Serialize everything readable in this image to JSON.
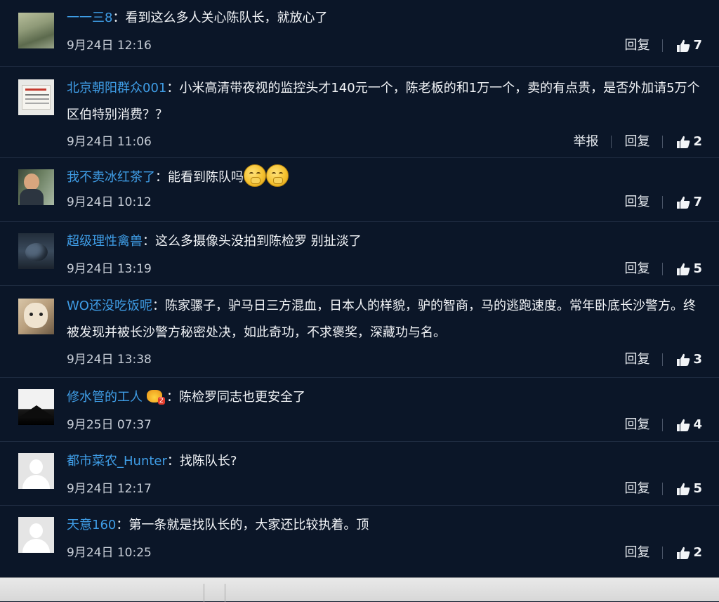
{
  "comments": [
    {
      "user": "一一三8",
      "text": "看到这么多人关心陈队长，就放心了",
      "time": "9月24日 12:16",
      "reply": "回复",
      "likes": "7"
    },
    {
      "user": "北京朝阳群众001",
      "text": "小米高清带夜视的监控头才140元一个，陈老板的和1万一个，卖的有点贵，是否外加请5万个区伯特别消费？？",
      "time": "9月24日 11:06",
      "report": "举报",
      "reply": "回复",
      "likes": "2"
    },
    {
      "user": "我不卖冰红茶了",
      "text": "能看到陈队吗",
      "time": "9月24日 10:12",
      "reply": "回复",
      "likes": "7",
      "emoji": "giggle-emoji"
    },
    {
      "user": "超级理性禽兽",
      "text": "这么多摄像头没拍到陈检罗 别扯淡了",
      "time": "9月24日 13:19",
      "reply": "回复",
      "likes": "5"
    },
    {
      "user": "WO还没吃饭呢",
      "text": "陈家骡子，驴马日三方混血，日本人的样貌，驴的智商，马的逃跑速度。常年卧底长沙警方。终被发现并被长沙警方秘密处决，如此奇功，不求褒奖，深藏功与名。",
      "time": "9月24日 13:38",
      "reply": "回复",
      "likes": "3"
    },
    {
      "user": "修水管的工人",
      "text": "陈检罗同志也更安全了",
      "time": "9月25日 07:37",
      "reply": "回复",
      "likes": "4",
      "badge": "vip-crown-icon"
    },
    {
      "user": "都市菜农_Hunter",
      "text": "找陈队长?",
      "time": "9月24日 12:17",
      "reply": "回复",
      "likes": "5"
    },
    {
      "user": "天意160",
      "text": "第一条就是找队长的，大家还比较执着。顶",
      "time": "9月24日 10:25",
      "reply": "回复",
      "likes": "2"
    }
  ],
  "colors": {
    "background": "#0b1628",
    "username": "#3f9de6",
    "text": "#f2f4f7",
    "meta": "#c9cfd8"
  }
}
